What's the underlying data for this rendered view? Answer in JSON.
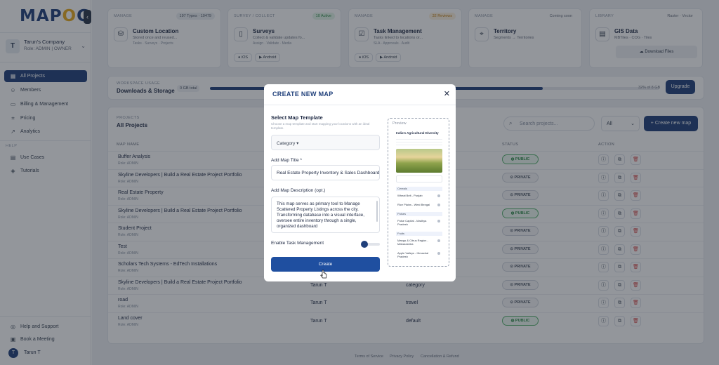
{
  "brand": {
    "logo_text_a": "MAP",
    "logo_text_o": "O",
    "logo_text_b": "G",
    "accent": "#1f3f7a",
    "gold": "#e9a91a"
  },
  "sidebar": {
    "company_initial": "T",
    "company_name": "Tarun's Company",
    "company_role": "Role: ADMIN | OWNER",
    "items": [
      {
        "label": "All Projects",
        "icon": "grid-icon"
      },
      {
        "label": "Members",
        "icon": "user-icon"
      },
      {
        "label": "Billing & Management",
        "icon": "card-icon"
      },
      {
        "label": "Pricing",
        "icon": "tag-icon"
      },
      {
        "label": "Analytics",
        "icon": "chart-icon"
      }
    ],
    "help_label": "HELP",
    "help_items": [
      {
        "label": "Use Cases",
        "icon": "book-icon"
      },
      {
        "label": "Tutorials",
        "icon": "layers-icon"
      }
    ],
    "bottom_items": [
      {
        "label": "Help and Support",
        "icon": "help-icon"
      },
      {
        "label": "Book a Meeting",
        "icon": "calendar-icon"
      }
    ],
    "user_initial": "T",
    "user_name": "Tarun T"
  },
  "cards": [
    {
      "cat": "MANAGE",
      "badge": "197 Types · 10479",
      "title": "Custom Location",
      "sub": "Stored once and reused...",
      "tags": "Tasks · Surveys · Projects"
    },
    {
      "cat": "SURVEY / COLLECT",
      "badge": "10 Active",
      "title": "Surveys",
      "sub": "Collect & validate updates fo...",
      "tags": "Assign · Validate · Media",
      "ios": "iOS",
      "android": "Android"
    },
    {
      "cat": "MANAGE",
      "badge": "32 Reviews",
      "title": "Task Management",
      "sub": "Tasks linked to locations or...",
      "tags": "SLA · Approvals · Audit",
      "ios": "iOS",
      "android": "Android"
    },
    {
      "cat": "MANAGE",
      "badge": "Coming soon",
      "title": "Territory",
      "sub": "Segments → Territories"
    },
    {
      "cat": "LIBRARY",
      "badge": "Raster · Vector",
      "title": "GIS Data",
      "sub": "MBTiles · COG · Tiles",
      "btn": "Download Files"
    }
  ],
  "usage": {
    "label": "WORKSPACE USAGE",
    "title": "Downloads & Storage",
    "pill": "0 GB total",
    "pct": "32% of 8 GB",
    "fill": 0.74,
    "upgrade": "Upgrade"
  },
  "projects": {
    "label": "PROJECTS",
    "title": "All Projects",
    "search_placeholder": "Search projects...",
    "filter": "All",
    "new_button": "+ Create new map",
    "col_name": "MAP NAME",
    "col_status": "STATUS",
    "col_action": "ACTION",
    "rows": [
      {
        "name": "Buffer Analysis",
        "role": "Role: ADMIN",
        "by": "",
        "cat": "",
        "status": "PUBLIC"
      },
      {
        "name": "Skyline Developers | Build a Real Estate Project Portfolio",
        "role": "Role: ADMIN",
        "by": "",
        "cat": "",
        "status": "PRIVATE"
      },
      {
        "name": "Real Estate Property",
        "role": "Role: ADMIN",
        "by": "",
        "cat": "",
        "status": "PRIVATE"
      },
      {
        "name": "Skyline Developers | Build a Real Estate Project Portfolio",
        "role": "Role: ADMIN",
        "by": "",
        "cat": "",
        "status": "PUBLIC"
      },
      {
        "name": "Student Project",
        "role": "Role: ADMIN",
        "by": "",
        "cat": "",
        "status": "PRIVATE"
      },
      {
        "name": "Test",
        "role": "Role: ADMIN",
        "by": "",
        "cat": "",
        "status": "PRIVATE"
      },
      {
        "name": "Scholars Tech Systems - EdTech Installations",
        "role": "Role: ADMIN",
        "by": "",
        "cat": "",
        "status": "PRIVATE"
      },
      {
        "name": "Skyline Developers | Build a Real Estate Project Portfolio",
        "role": "Role: ADMIN",
        "by": "Tarun T",
        "cat": "category",
        "status": "PRIVATE"
      },
      {
        "name": "road",
        "role": "Role: ADMIN",
        "by": "Tarun T",
        "cat": "travel",
        "status": "PRIVATE"
      },
      {
        "name": "Land cover",
        "role": "Role: ADMIN",
        "by": "Tarun T",
        "cat": "default",
        "status": "PUBLIC"
      }
    ]
  },
  "footer": {
    "terms": "Terms of Service",
    "privacy": "Privacy Policy",
    "refund": "Cancellation & Refund"
  },
  "modal": {
    "title": "CREATE NEW MAP",
    "select_template": "Select Map Template",
    "hint": "Choose a map template and start mapping your locations with an ideal template.",
    "category": "Category",
    "title_label": "Add Map Title *",
    "title_value": "Real Estate Property Inventory & Sales Dashboard",
    "desc_label": "Add Map Description (opt.)",
    "desc_value": "This map serves as primary tool to Manage Scattered Property Listings across the city. Transforming database into a visual interface, oversee entire inventory through a single, organized dashboard",
    "task_label": "Enable Task Management",
    "task_enabled": false,
    "create": "Create",
    "preview": {
      "label": "Preview",
      "title": "India's Agricultural Diversity",
      "groups": [
        {
          "label": "Cereals",
          "items": [
            "Wheat Belt - Punjab",
            "Rice Plains - West Bengal"
          ]
        },
        {
          "label": "Pulses",
          "items": [
            "Pulse Capital - Madhya Pradesh"
          ]
        },
        {
          "label": "Fruits",
          "items": [
            "Mango & Citrus Region - Maharashtra",
            "Apple Valleys - Himachal Pradesh"
          ]
        }
      ]
    }
  }
}
